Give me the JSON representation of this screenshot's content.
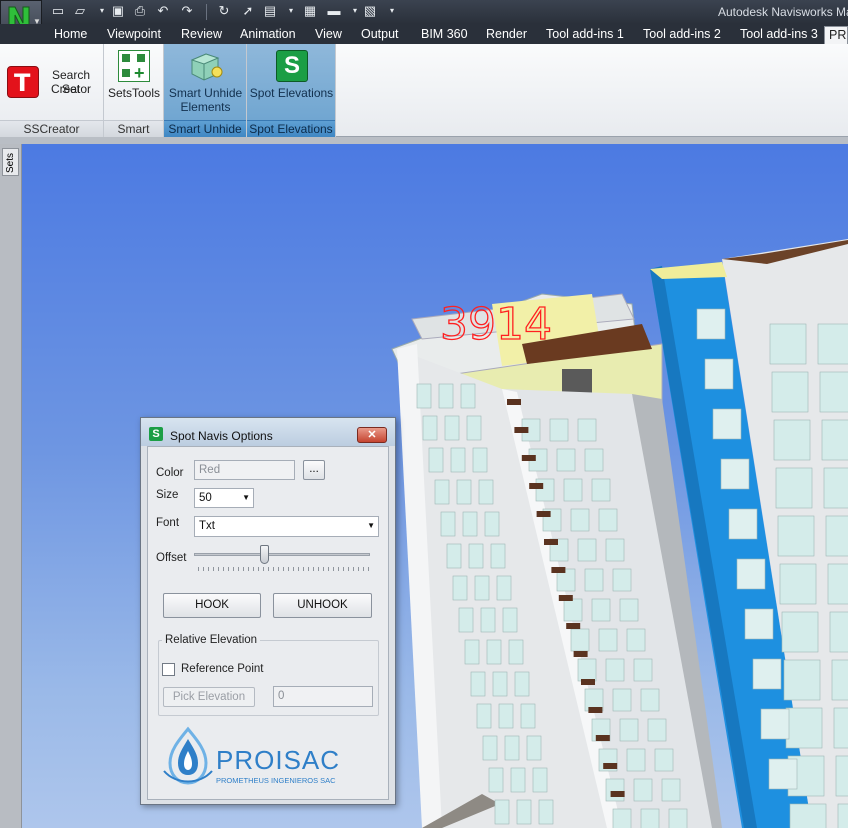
{
  "app": {
    "title": "Autodesk Navisworks Ma",
    "app_button_letter": "N"
  },
  "quick_access": {
    "icons": [
      "new-icon",
      "open-icon",
      "save-icon",
      "print-icon",
      "undo-icon",
      "redo-icon",
      "refresh-icon",
      "select-icon",
      "box-icon",
      "properties-icon",
      "measure-icon",
      "image-icon",
      "customize-icon"
    ]
  },
  "tabs": [
    "Home",
    "Viewpoint",
    "Review",
    "Animation",
    "View",
    "Output",
    "BIM 360",
    "Render",
    "Tool add-ins 1",
    "Tool add-ins 2",
    "Tool add-ins 3",
    "PR"
  ],
  "ribbon": {
    "groups": [
      {
        "label": "SSCreator",
        "button": "Search Set Creator",
        "button_line1": "Search Set",
        "button_line2": "Creator"
      },
      {
        "label": "Smart",
        "button": "SetsTools"
      },
      {
        "label": "Smart Unhide",
        "button_line1": "Smart Unhide",
        "button_line2": "Elements"
      },
      {
        "label": "Spot Elevations",
        "button": "Spot Elevations"
      }
    ]
  },
  "sidebar": {
    "tab_label": "Sets"
  },
  "viewport": {
    "annotation_text": "3914",
    "annotation_color": "#ff2020",
    "sky_color": "#5a86e2"
  },
  "dialog": {
    "title": "Spot Navis Options",
    "close_symbol": "✕",
    "color_label": "Color",
    "color_value": "Red",
    "browse_label": "...",
    "size_label": "Size",
    "size_value": "50",
    "font_label": "Font",
    "font_value": "Txt",
    "offset_label": "Offset",
    "offset_fraction": 0.4,
    "hook_label": "HOOK",
    "unhook_label": "UNHOOK",
    "relative_elevation_label": "Relative Elevation",
    "reference_point_label": "Reference Point",
    "reference_point_checked": false,
    "pick_elevation_label": "Pick Elevation",
    "elevation_value": "0",
    "logo_name": "PROISAC",
    "logo_tagline": "PROMETHEUS INGENIEROS SAC",
    "logo_color": "#2f7fc8"
  }
}
